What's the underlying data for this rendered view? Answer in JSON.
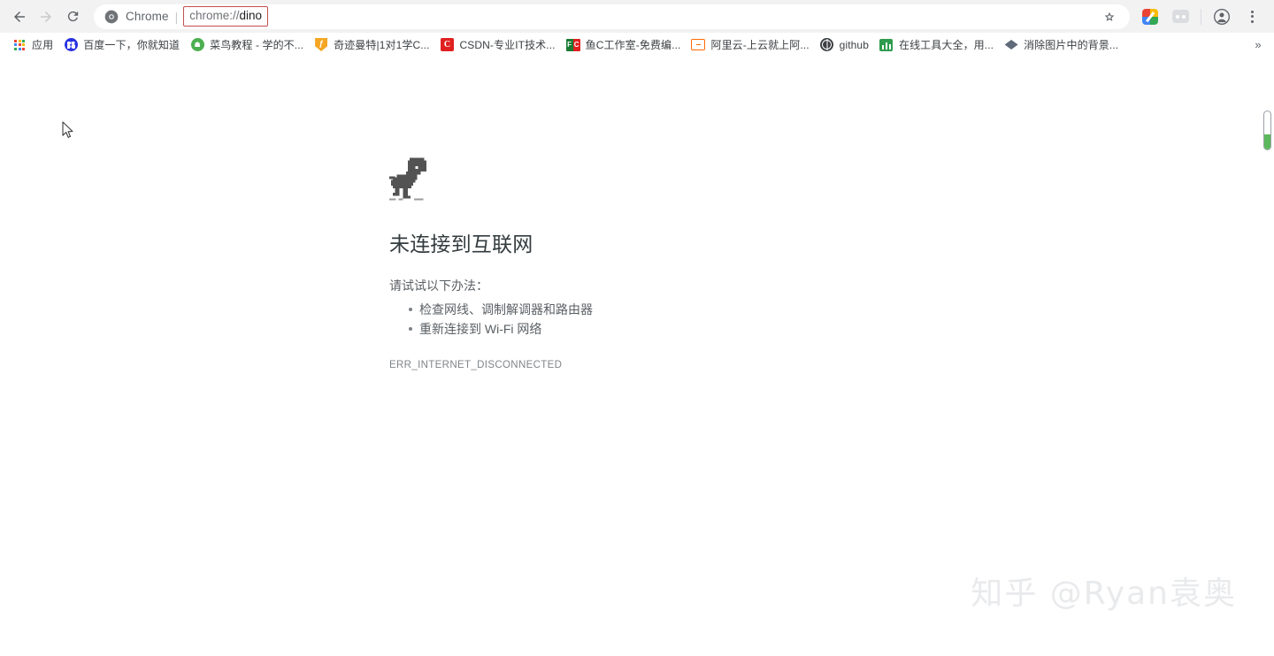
{
  "browser": {
    "nav": {
      "back_label": "Back",
      "back_icon": "arrow-left-icon",
      "forward_label": "Forward",
      "forward_icon": "arrow-right-icon",
      "reload_label": "Reload",
      "reload_icon": "reload-icon"
    },
    "omnibox": {
      "site_icon": "chrome-icon",
      "site_label": "Chrome",
      "separator": "|",
      "url_scheme": "chrome://",
      "url_host": "dino",
      "url_full": "chrome://dino",
      "highlight_color": "#c0504d",
      "star_icon": "star-outline-icon",
      "star_label": "Bookmark this tab"
    },
    "toolbar_icons": [
      {
        "name": "extension-google-icon",
        "label": "Google extension"
      },
      {
        "name": "extensions-puzzle-icon",
        "label": "Extensions"
      },
      {
        "name": "profile-avatar-icon",
        "label": "Profile"
      },
      {
        "name": "chrome-menu-icon",
        "label": "Customize and control Google Chrome"
      }
    ],
    "bookmarks": {
      "overflow_label": "»",
      "items": [
        {
          "icon": "apps-grid-icon",
          "label": "应用"
        },
        {
          "icon": "baidu-icon",
          "label": "百度一下，你就知道"
        },
        {
          "icon": "runoob-icon",
          "label": "菜鸟教程 - 学的不..."
        },
        {
          "icon": "qijimante-icon",
          "label": "奇迹曼特|1对1学C..."
        },
        {
          "icon": "csdn-icon",
          "label": "CSDN-专业IT技术..."
        },
        {
          "icon": "fishc-icon",
          "label": "鱼C工作室-免费编..."
        },
        {
          "icon": "aliyun-icon",
          "label": "阿里云-上云就上阿..."
        },
        {
          "icon": "github-icon",
          "label": "github"
        },
        {
          "icon": "online-tools-icon",
          "label": "在线工具大全，用..."
        },
        {
          "icon": "remove-bg-icon",
          "label": "消除图片中的背景..."
        }
      ]
    }
  },
  "page": {
    "dino_icon": "dinosaur-icon",
    "title": "未连接到互联网",
    "lead": "请试试以下办法：",
    "suggestions": [
      "检查网线、调制解调器和路由器",
      "重新连接到 Wi-Fi 网络"
    ],
    "error_code": "ERR_INTERNET_DISCONNECTED",
    "watermark": "知乎 @Ryan袁奥"
  },
  "scrollbar": {
    "name": "vertical-scrollbar",
    "thumb_color": "#ffffff",
    "marker_color": "#5cb85c"
  },
  "colors": {
    "toolbar_bg": "#f2f2f3",
    "page_bg": "#ffffff",
    "text_primary": "#333b3e",
    "text_secondary": "#5a5f63",
    "url_highlight": "#c0504d",
    "watermark": "#e9eaec"
  }
}
